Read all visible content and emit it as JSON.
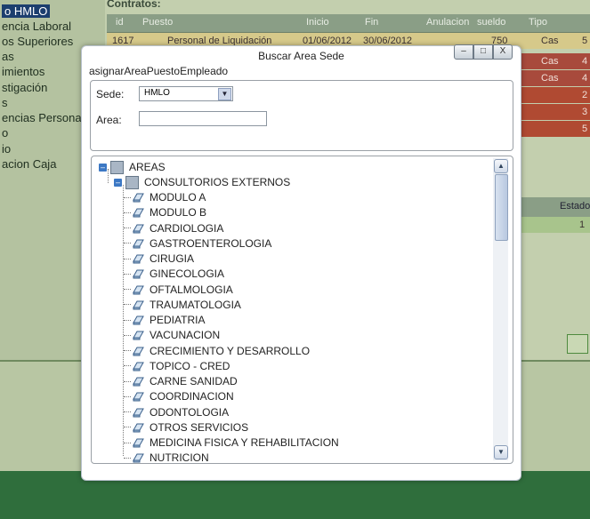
{
  "left_nav": {
    "items": [
      {
        "label": "o HMLO",
        "selected": true
      },
      {
        "label": "encia Laboral"
      },
      {
        "label": "os Superiores"
      },
      {
        "label": "as"
      },
      {
        "label": "imientos"
      },
      {
        "label": "stigación"
      },
      {
        "label": "s"
      },
      {
        "label": "encias Personal"
      },
      {
        "label": "o"
      },
      {
        "label": "io"
      },
      {
        "label": "acion Caja"
      }
    ]
  },
  "contracts": {
    "title": "Contratos:",
    "columns": [
      "id",
      "Puesto",
      "Inicio",
      "Fin",
      "Anulacion",
      "sueldo",
      "Tipo"
    ],
    "rows": [
      {
        "id": "1617",
        "puesto": "Personal de Liquidación",
        "inicio": "01/06/2012",
        "fin": "30/06/2012",
        "sueldo": "750",
        "tipo": "Cas",
        "extra": "5"
      },
      {
        "tipo": "Cas",
        "extra": "4"
      },
      {
        "tipo": "Cas",
        "extra": "4"
      },
      {
        "extra": "2"
      },
      {
        "extra": "3"
      },
      {
        "extra": "5"
      }
    ]
  },
  "secondary_panel": {
    "header": "Estado",
    "value": "1"
  },
  "dialog": {
    "title": "Buscar Area Sede",
    "buttons": {
      "minimize": "–",
      "maximize": "□",
      "close": "X"
    },
    "form_name": "asignarAreaPuestoEmpleado",
    "sede": {
      "label": "Sede:",
      "value": "HMLO"
    },
    "area": {
      "label": "Area:",
      "value": ""
    }
  },
  "tree": {
    "root": "AREAS",
    "group": "CONSULTORIOS EXTERNOS",
    "items": [
      "MODULO A",
      "MODULO B",
      "CARDIOLOGIA",
      "GASTROENTEROLOGIA",
      "CIRUGIA",
      "GINECOLOGIA",
      "OFTALMOLOGIA",
      "TRAUMATOLOGIA",
      "PEDIATRIA",
      "VACUNACION",
      "CRECIMIENTO Y DESARROLLO",
      "TOPICO - CRED",
      "CARNE SANIDAD",
      "COORDINACION",
      "ODONTOLOGIA",
      "OTROS SERVICIOS",
      "MEDICINA FISICA Y REHABILITACION",
      "NUTRICION"
    ]
  },
  "colors": {
    "selected_nav": "#1c3e6e",
    "row_red": "#a84a3c",
    "row_gold": "#b8b26a",
    "bottom_green": "#2f6e3c"
  }
}
